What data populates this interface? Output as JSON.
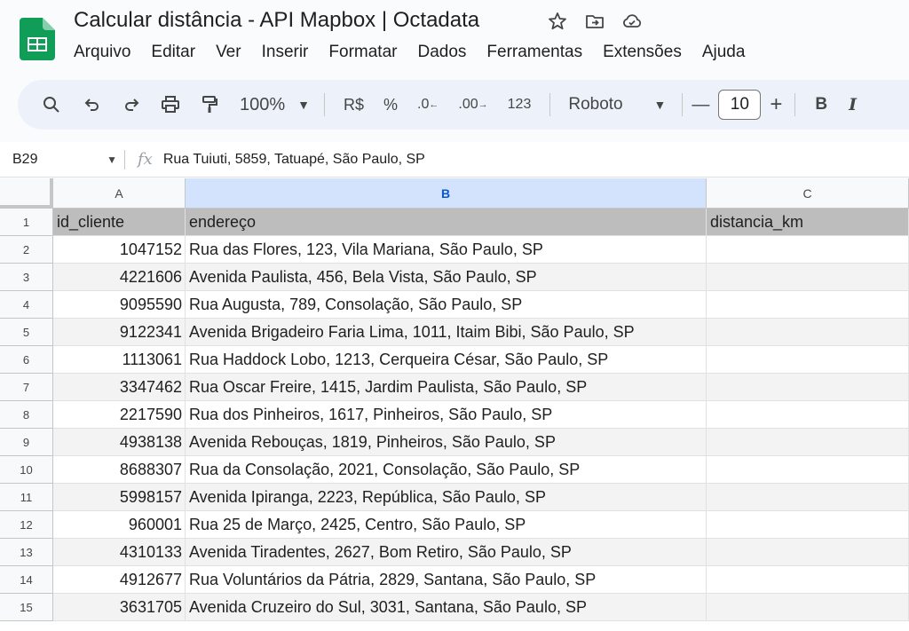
{
  "app": {
    "title": "Calcular distância - API Mapbox | Octadata",
    "menu": [
      "Arquivo",
      "Editar",
      "Ver",
      "Inserir",
      "Formatar",
      "Dados",
      "Ferramentas",
      "Extensões",
      "Ajuda"
    ]
  },
  "toolbar": {
    "zoom": "100%",
    "currency": "R$",
    "percent": "%",
    "decrease_decimals": ".0",
    "increase_decimals": ".00",
    "number_format": "123",
    "font": "Roboto",
    "font_size": "10",
    "minus": "—",
    "plus": "+",
    "bold": "B",
    "italic": "I"
  },
  "formula_bar": {
    "cell_ref": "B29",
    "fx": "fx",
    "content": "Rua Tuiuti, 5859, Tatuapé, São Paulo, SP"
  },
  "grid": {
    "columns": [
      "A",
      "B",
      "C"
    ],
    "selected_column": "B",
    "rows": [
      {
        "n": "1",
        "a": "id_cliente",
        "b": "endereço",
        "c": "distancia_km"
      },
      {
        "n": "2",
        "a": "1047152",
        "b": "Rua das Flores, 123, Vila Mariana, São Paulo, SP",
        "c": ""
      },
      {
        "n": "3",
        "a": "4221606",
        "b": "Avenida Paulista, 456, Bela Vista, São Paulo, SP",
        "c": ""
      },
      {
        "n": "4",
        "a": "9095590",
        "b": "Rua Augusta, 789, Consolação, São Paulo, SP",
        "c": ""
      },
      {
        "n": "5",
        "a": "9122341",
        "b": "Avenida Brigadeiro Faria Lima, 1011, Itaim Bibi, São Paulo, SP",
        "c": ""
      },
      {
        "n": "6",
        "a": "1113061",
        "b": "Rua Haddock Lobo, 1213, Cerqueira César, São Paulo, SP",
        "c": ""
      },
      {
        "n": "7",
        "a": "3347462",
        "b": "Rua Oscar Freire, 1415, Jardim Paulista, São Paulo, SP",
        "c": ""
      },
      {
        "n": "8",
        "a": "2217590",
        "b": "Rua dos Pinheiros, 1617, Pinheiros, São Paulo, SP",
        "c": ""
      },
      {
        "n": "9",
        "a": "4938138",
        "b": "Avenida Rebouças, 1819, Pinheiros, São Paulo, SP",
        "c": ""
      },
      {
        "n": "10",
        "a": "8688307",
        "b": "Rua da Consolação, 2021, Consolação, São Paulo, SP",
        "c": ""
      },
      {
        "n": "11",
        "a": "5998157",
        "b": "Avenida Ipiranga, 2223, República, São Paulo, SP",
        "c": ""
      },
      {
        "n": "12",
        "a": "960001",
        "b": "Rua 25 de Março, 2425, Centro, São Paulo, SP",
        "c": ""
      },
      {
        "n": "13",
        "a": "4310133",
        "b": "Avenida Tiradentes, 2627, Bom Retiro, São Paulo, SP",
        "c": ""
      },
      {
        "n": "14",
        "a": "4912677",
        "b": "Rua Voluntários da Pátria, 2829, Santana, São Paulo, SP",
        "c": ""
      },
      {
        "n": "15",
        "a": "3631705",
        "b": "Avenida Cruzeiro do Sul, 3031, Santana, São Paulo, SP",
        "c": ""
      }
    ]
  },
  "colors": {
    "header_fill": "#bdbdbd",
    "alt_row_fill": "#f3f3f3",
    "selected_col": "#d3e3fd",
    "sheets_green": "#0f9d58"
  }
}
